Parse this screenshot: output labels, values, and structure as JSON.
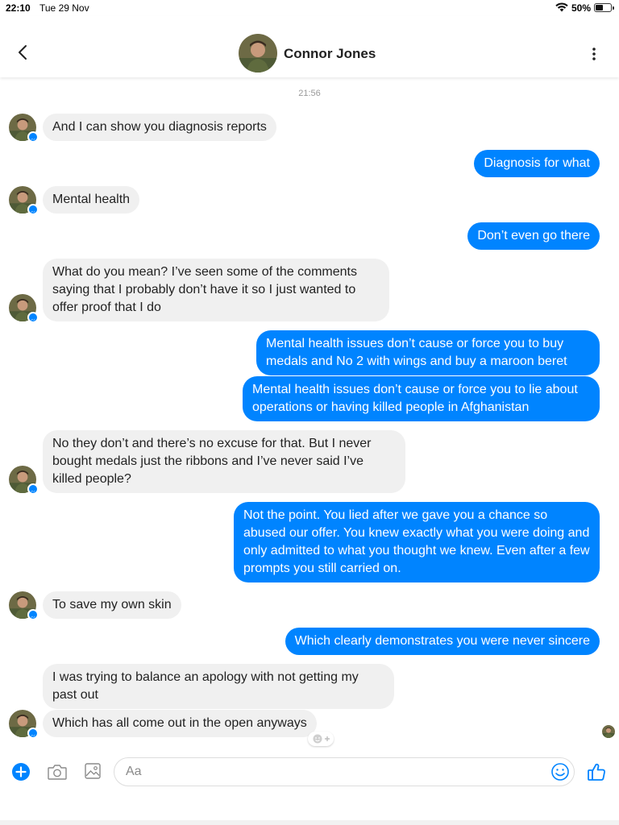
{
  "status_bar": {
    "time": "22:10",
    "date": "Tue 29 Nov",
    "battery": "50%"
  },
  "header": {
    "contact_name": "Connor Jones"
  },
  "conversation": {
    "timestamp": "21:56",
    "messages": [
      {
        "from": "them",
        "text": "And I can show you diagnosis reports"
      },
      {
        "from": "me",
        "text": "Diagnosis for what"
      },
      {
        "from": "them",
        "text": "Mental health"
      },
      {
        "from": "me",
        "text": "Don’t even go there"
      },
      {
        "from": "them",
        "text": "What do you mean? I’ve seen some of the comments saying that I probably don’t have it so I just wanted to offer proof that I do"
      },
      {
        "from": "me",
        "text": "Mental health issues don’t cause or force you to buy medals and No 2 with wings and buy a maroon beret"
      },
      {
        "from": "me",
        "text": "Mental health issues don’t cause or force you to lie about operations or having killed people in Afghanistan"
      },
      {
        "from": "them",
        "text": "No they don’t and there’s no excuse for that. But I never bought medals just the ribbons and I’ve never said I’ve killed people?"
      },
      {
        "from": "me",
        "text": "Not the point. You lied after we gave you a chance so abused our offer. You knew exactly what you were doing and only admitted to what you thought we knew. Even after a few prompts you still carried on."
      },
      {
        "from": "them",
        "text": "To save my own skin"
      },
      {
        "from": "me",
        "text": "Which clearly demonstrates you were never sincere"
      },
      {
        "from": "them",
        "text": "I was trying to balance an apology with not getting my past out"
      },
      {
        "from": "them",
        "text": "Which has all come out in the open anyways"
      }
    ]
  },
  "composer": {
    "placeholder": "Aa"
  },
  "colors": {
    "accent": "#0084ff",
    "incoming_bubble": "#f0f0f0",
    "outgoing_text": "#ffffff"
  },
  "icons": [
    "back-icon",
    "more-vertical-icon",
    "messenger-badge-icon",
    "plus-icon",
    "camera-icon",
    "gallery-icon",
    "emoji-icon",
    "thumbs-up-icon",
    "add-reaction-icon",
    "wifi-icon",
    "battery-icon"
  ]
}
